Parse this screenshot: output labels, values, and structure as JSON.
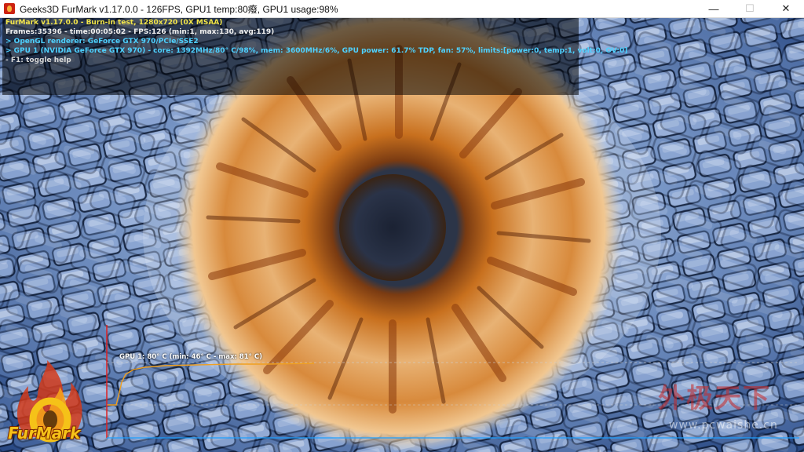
{
  "titlebar": {
    "title": "Geeks3D FurMark v1.17.0.0 - 126FPS, GPU1 temp:80癈, GPU1 usage:98%",
    "minimize_glyph": "—",
    "maximize_glyph": "☐",
    "close_glyph": "✕"
  },
  "overlay": {
    "line1": "FurMark v1.17.0.0 - Burn-in test, 1280x720 (0X MSAA)",
    "line2": "Frames:35396 - time:00:05:02 - FPS:126 (min:1, max:130, avg:119)",
    "line3": "> OpenGL renderer: GeForce GTX 970/PCIe/SSE2",
    "line4": "> GPU 1 (NVIDIA GeForce GTX 970) - core: 1392MHz/80° C/98%, mem: 3600MHz/6%, GPU power: 61.7% TDP, fan: 57%, limits:[power:0, temp:1, volt:0, OV:0]",
    "line5": "- F1: toggle help"
  },
  "graph": {
    "label": "GPU 1: 80° C (min: 46° C - max: 81° C)",
    "current_c": 80,
    "min_c": 46,
    "max_c": 81
  },
  "logo": {
    "text": "FurMark"
  },
  "watermark": {
    "cn": "外极天下",
    "url": "www.pcwaishe.cn"
  },
  "colors": {
    "overlay_yellow": "#f3e649",
    "overlay_cyan": "#4ed1ff",
    "graph_line": "#f0a020",
    "graph_axis": "#e02020",
    "iris_orange": "#c8701e",
    "pupil": "#20283a"
  },
  "icons": {
    "app": "furmark-flame-icon",
    "minimize": "minimize-icon",
    "maximize": "maximize-icon",
    "close": "close-icon"
  }
}
